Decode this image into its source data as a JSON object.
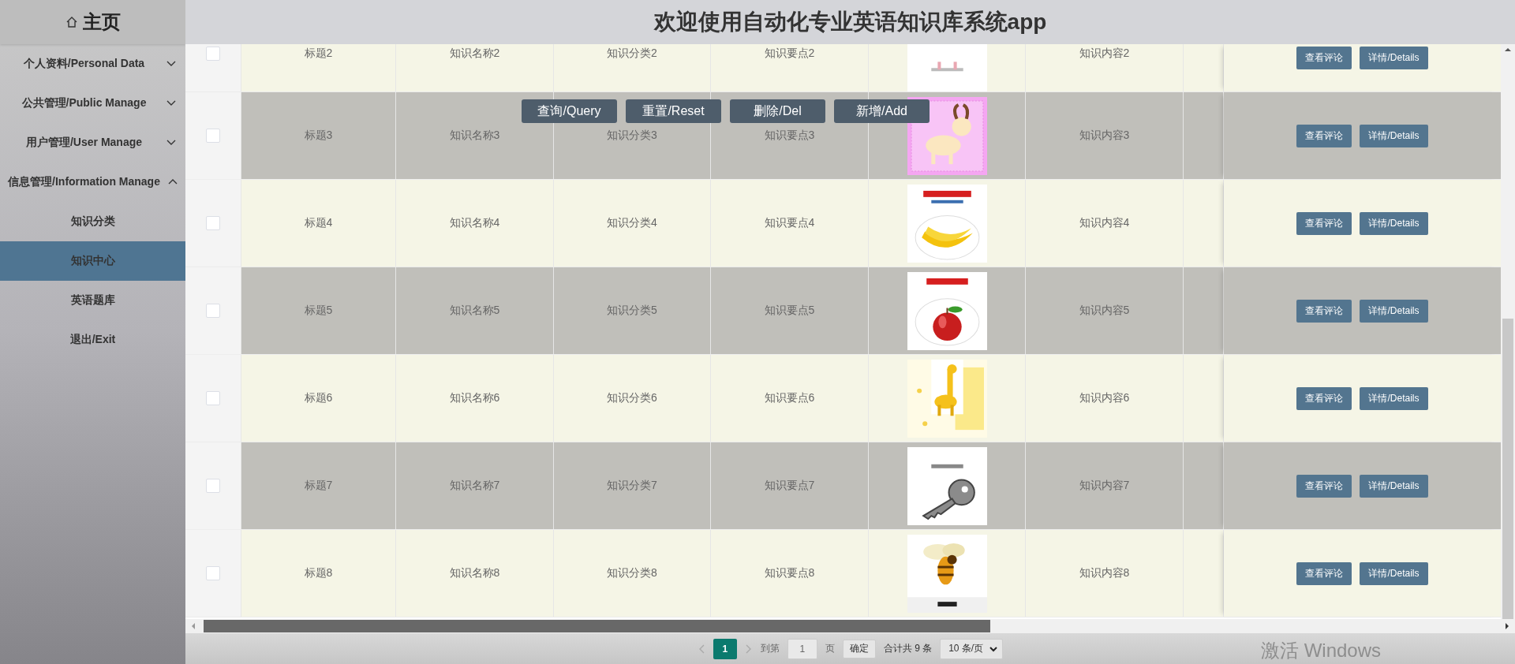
{
  "sidebar": {
    "title": "主页",
    "items": [
      {
        "kind": "group",
        "label": "个人资料/Personal Data",
        "expanded": false
      },
      {
        "kind": "group",
        "label": "公共管理/Public Manage",
        "expanded": false
      },
      {
        "kind": "group",
        "label": "用户管理/User Manage",
        "expanded": false
      },
      {
        "kind": "group",
        "label": "信息管理/Information Manage",
        "expanded": true,
        "children": [
          {
            "kind": "link",
            "label": "知识分类",
            "selected": false
          },
          {
            "kind": "link",
            "label": "知识中心",
            "selected": true
          },
          {
            "kind": "link",
            "label": "英语题库",
            "selected": false
          }
        ]
      },
      {
        "kind": "link",
        "label": "退出/Exit",
        "selected": false
      }
    ]
  },
  "header": {
    "title": "欢迎使用自动化专业英语知识库系统app"
  },
  "toolbar": {
    "buttons": [
      "查询/Query",
      "重置/Reset",
      "删除/Del",
      "新增/Add"
    ]
  },
  "table": {
    "rows": [
      {
        "checked": false,
        "cells": [
          "标题2",
          "知识名称2",
          "知识分类2",
          "知识要点2"
        ],
        "image": {
          "kind": "picture"
        },
        "content": "知识内容2",
        "actions": [
          "查看评论",
          "详情/Details"
        ]
      },
      {
        "checked": false,
        "cells": [
          "标题3",
          "知识名称3",
          "知识分类3",
          "知识要点3"
        ],
        "image": {
          "kind": "picture"
        },
        "content": "知识内容3",
        "actions": [
          "查看评论",
          "详情/Details"
        ]
      },
      {
        "checked": false,
        "cells": [
          "标题4",
          "知识名称4",
          "知识分类4",
          "知识要点4"
        ],
        "image": {
          "kind": "picture"
        },
        "content": "知识内容4",
        "actions": [
          "查看评论",
          "详情/Details"
        ]
      },
      {
        "checked": false,
        "cells": [
          "标题5",
          "知识名称5",
          "知识分类5",
          "知识要点5"
        ],
        "image": {
          "kind": "picture"
        },
        "content": "知识内容5",
        "actions": [
          "查看评论",
          "详情/Details"
        ]
      },
      {
        "checked": false,
        "cells": [
          "标题6",
          "知识名称6",
          "知识分类6",
          "知识要点6"
        ],
        "image": {
          "kind": "picture"
        },
        "content": "知识内容6",
        "actions": [
          "查看评论",
          "详情/Details"
        ]
      },
      {
        "checked": false,
        "cells": [
          "标题7",
          "知识名称7",
          "知识分类7",
          "知识要点7"
        ],
        "image": {
          "kind": "picture"
        },
        "content": "知识内容7",
        "actions": [
          "查看评论",
          "详情/Details"
        ]
      },
      {
        "checked": false,
        "cells": [
          "标题8",
          "知识名称8",
          "知识分类8",
          "知识要点8"
        ],
        "image": {
          "kind": "picture"
        },
        "content": "知识内容8",
        "actions": [
          "查看评论",
          "详情/Details"
        ]
      }
    ]
  },
  "pagination": {
    "pages": [
      {
        "label": "1",
        "selected": true
      }
    ],
    "goto_label": "到第",
    "page_input": "1",
    "page_unit": "页",
    "confirm": "确定",
    "total": "合计共 9 条",
    "page_size": "10 条/页"
  },
  "os_notice": "激活 Windows"
}
